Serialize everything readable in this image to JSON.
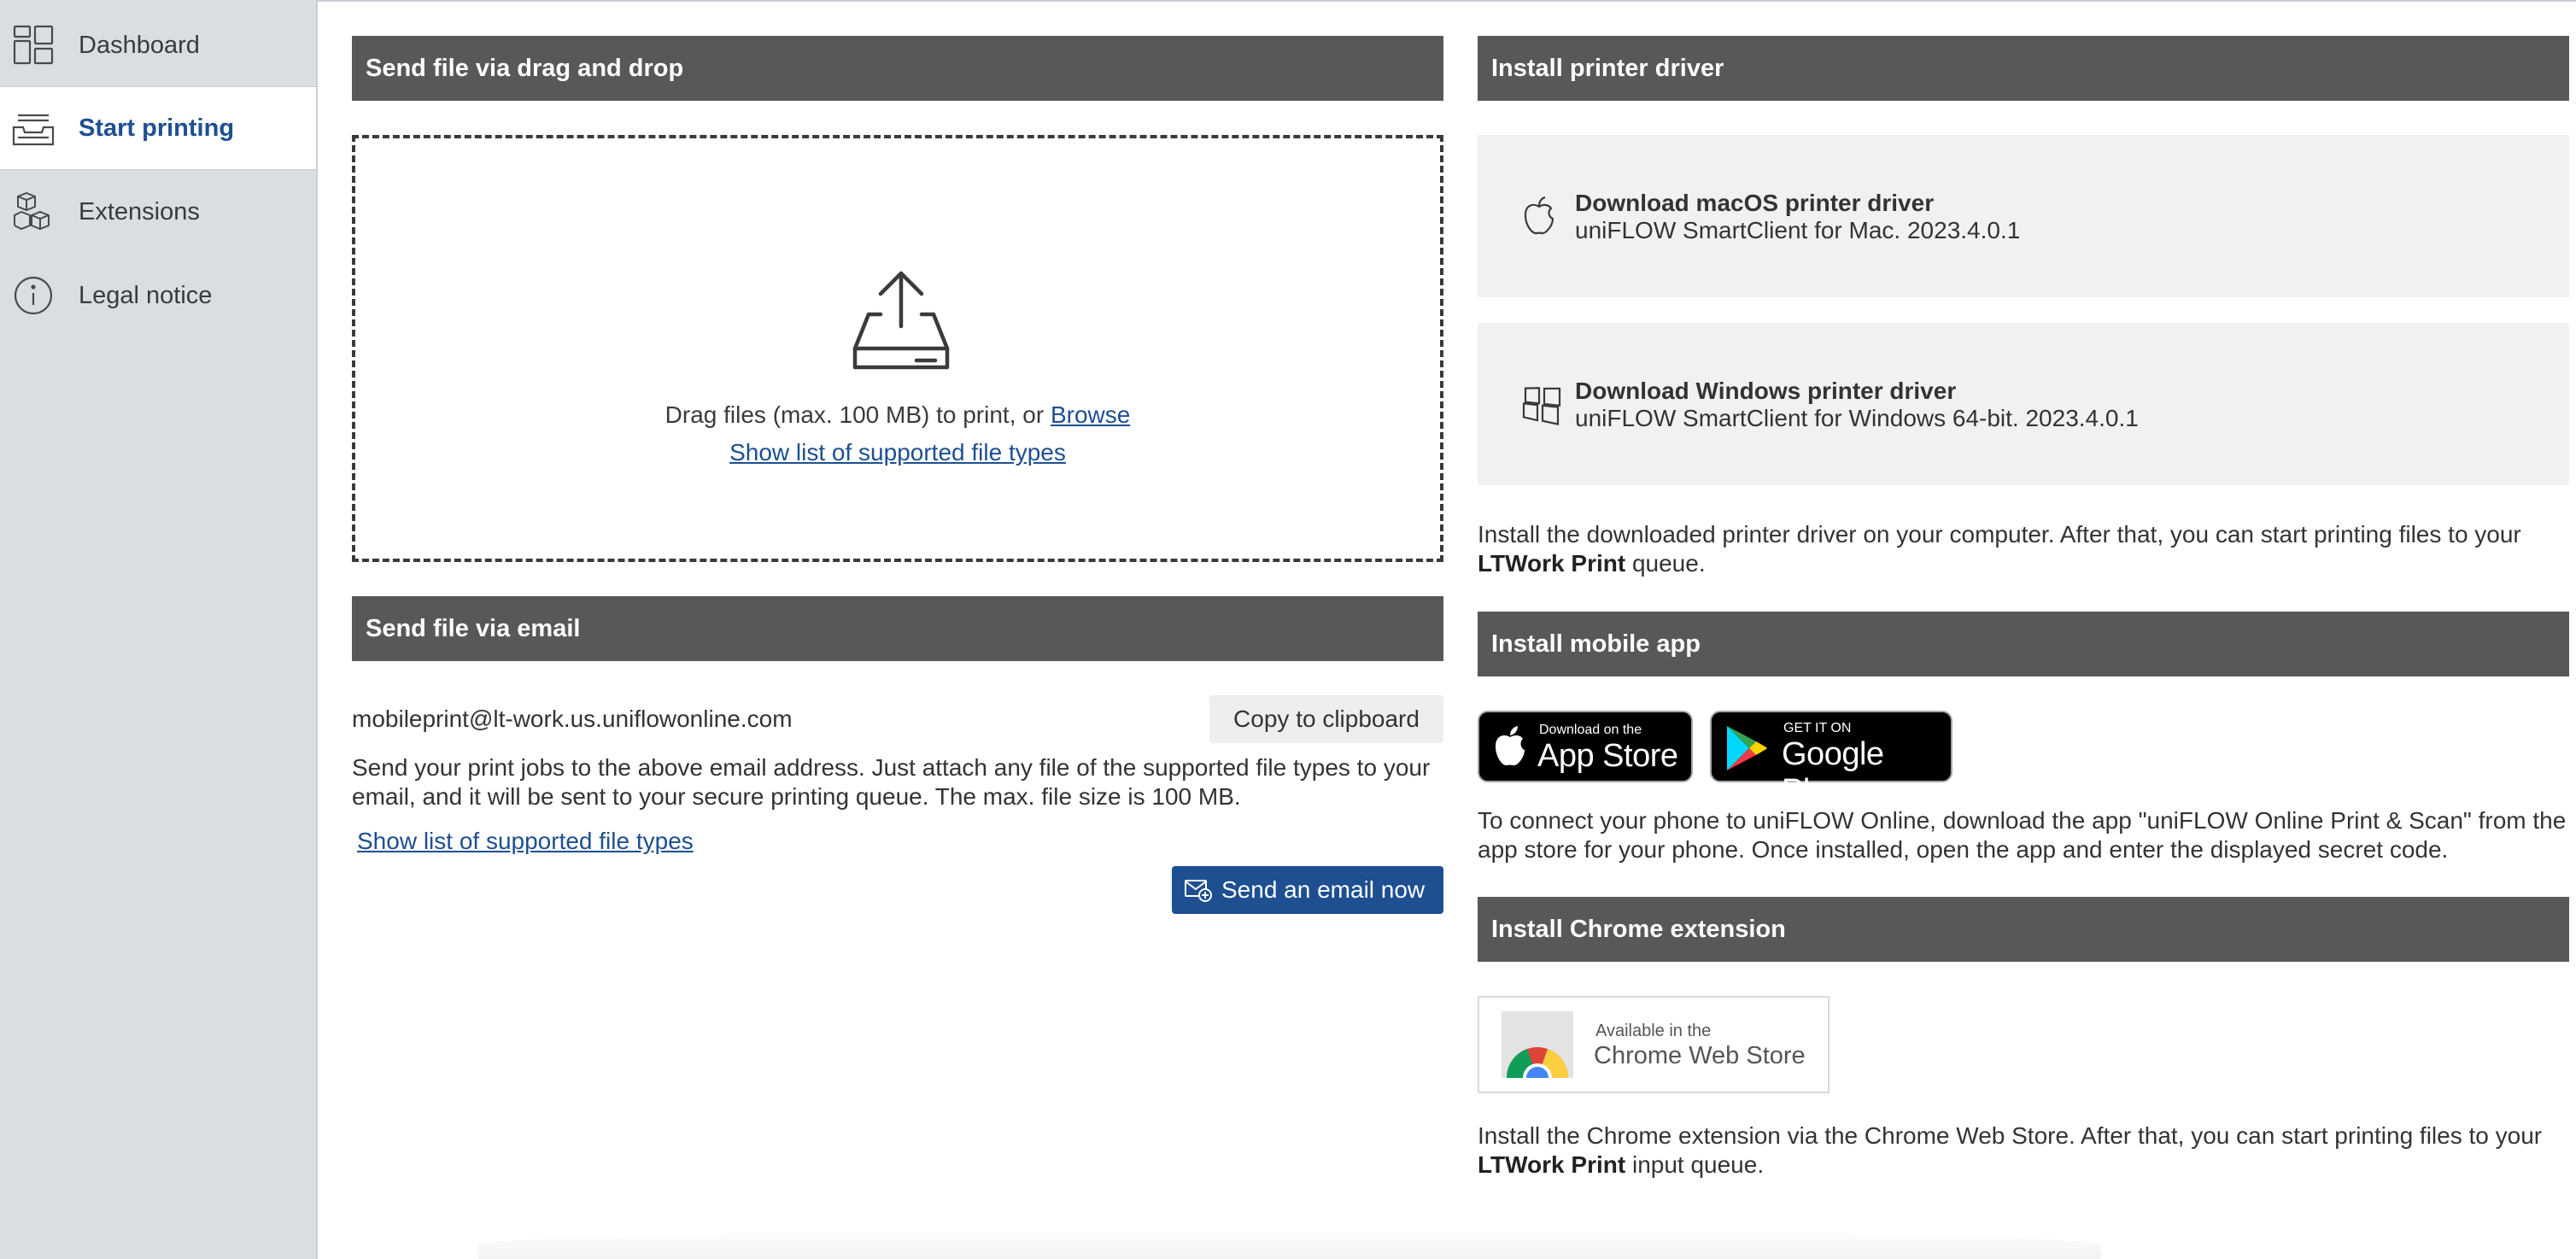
{
  "sidebar": {
    "items": [
      {
        "label": "Dashboard",
        "icon": "dashboard-icon"
      },
      {
        "label": "Start printing",
        "icon": "printer-tray-icon",
        "active": true
      },
      {
        "label": "Extensions",
        "icon": "cubes-icon"
      },
      {
        "label": "Legal notice",
        "icon": "info-icon"
      }
    ]
  },
  "dragdrop": {
    "header": "Send file via drag and drop",
    "drag_text": "Drag files (max. 100 MB) to print, or",
    "browse": "Browse",
    "show_list": "Show list of supported file types"
  },
  "email": {
    "header": "Send file via email",
    "address": "mobileprint@lt-work.us.uniflowonline.com",
    "copy_button": "Copy to clipboard",
    "description": "Send your print jobs to the above email address. Just attach any file of the supported file types to your email, and it will be sent to your secure printing queue. The max. file size is 100 MB.",
    "show_list": "Show list of supported file types",
    "send_button": "Send an email now"
  },
  "driver": {
    "header": "Install printer driver",
    "mac": {
      "title": "Download macOS printer driver",
      "subtitle": "uniFLOW SmartClient for Mac. 2023.4.0.1"
    },
    "windows": {
      "title": "Download Windows printer driver",
      "subtitle": "uniFLOW SmartClient for Windows 64-bit. 2023.4.0.1"
    },
    "instructions_pre": "Install the downloaded printer driver on your computer. After that, you can start printing files to your",
    "queue_name": "LTWork Print",
    "instructions_post": "queue."
  },
  "mobile": {
    "header": "Install mobile app",
    "appstore_small": "Download on the",
    "appstore_big": "App Store",
    "googleplay_small": "GET IT ON",
    "googleplay_big": "Google Play",
    "instructions": "To connect your phone to uniFLOW Online, download the app \"uniFLOW Online Print & Scan\" from the app store for your phone. Once installed, open the app and enter the displayed secret code."
  },
  "chrome": {
    "header": "Install Chrome extension",
    "badge_small": "Available in the",
    "badge_big": "Chrome Web Store",
    "instructions_pre": "Install the Chrome extension via the Chrome Web Store. After that, you can start printing files to your",
    "queue_name": "LTWork Print",
    "instructions_post": "input queue."
  },
  "colors": {
    "header_bg": "#595856",
    "sidebar_bg": "#d9dee3",
    "accent": "#1d4f91",
    "card_bg": "#f0f1f3"
  }
}
